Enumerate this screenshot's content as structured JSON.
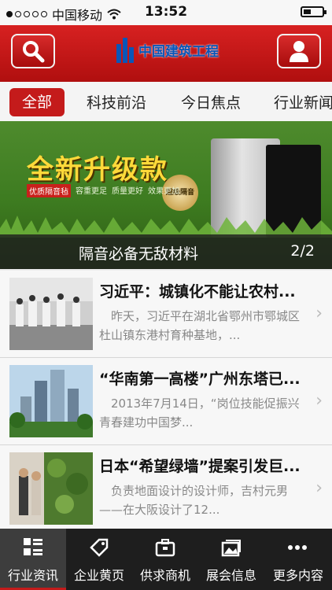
{
  "status_bar": {
    "carrier": "中国移动",
    "time": "13:52"
  },
  "header": {
    "logo_text": "中国建筑工程"
  },
  "tabs": [
    {
      "label": "全部",
      "active": true
    },
    {
      "label": "科技前沿"
    },
    {
      "label": "今日焦点"
    },
    {
      "label": "行业新闻"
    }
  ],
  "banner": {
    "headline": "全新升级款",
    "badge": "超级隔音",
    "tag": "优质隔音毡",
    "slogans": [
      "容重更足",
      "质量更好",
      "效果更加"
    ],
    "caption": "隔音必备无敌材料",
    "page": "2/2"
  },
  "news": [
    {
      "title": "习近平：城镇化不能让农村...",
      "summary": "昨天，习近平在湖北省鄂州市鄂城区杜山镇东港村育种基地，..."
    },
    {
      "title": "“华南第一高楼”广州东塔已...",
      "summary": "2013年7月14日，“岗位技能促振兴青春建功中国梦..."
    },
    {
      "title": "日本“希望绿墙”提案引发巨...",
      "summary": "负责地面设计的设计师，吉村元男——在大阪设计了12..."
    }
  ],
  "tab_bar": [
    {
      "label": "行业资讯",
      "icon": "list-icon",
      "active": true
    },
    {
      "label": "企业黄页",
      "icon": "tag-icon"
    },
    {
      "label": "供求商机",
      "icon": "briefcase-icon"
    },
    {
      "label": "展会信息",
      "icon": "photos-icon"
    },
    {
      "label": "更多内容",
      "icon": "more-icon"
    }
  ],
  "colors": {
    "brand_red": "#c41b1b",
    "tab_bar_bg": "#1e1e1e"
  }
}
